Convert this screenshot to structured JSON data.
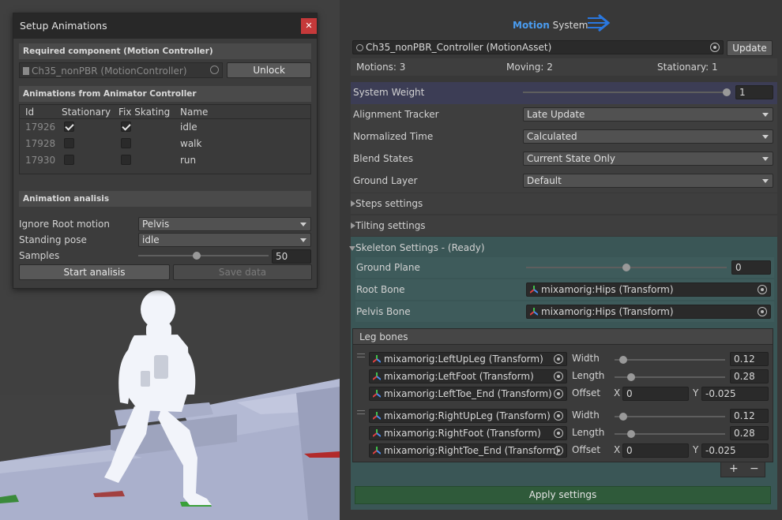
{
  "setup_window": {
    "title": "Setup Animations",
    "close_icon": "close-icon",
    "required_section": "Required component (Motion Controller)",
    "controller_field": "Ch35_nonPBR (MotionController)",
    "unlock_label": "Unlock",
    "animations_section": "Animations from Animator Controller",
    "columns": [
      "Id",
      "Stationary",
      "Fix Skating",
      "Name"
    ],
    "rows": [
      {
        "id": "17926",
        "stationary": true,
        "fix_skating": true,
        "name": "idle"
      },
      {
        "id": "17928",
        "stationary": false,
        "fix_skating": false,
        "name": "walk"
      },
      {
        "id": "17930",
        "stationary": false,
        "fix_skating": false,
        "name": "run"
      }
    ],
    "analysis_section": "Animation analisis",
    "ignore_root_label": "Ignore Root motion",
    "ignore_root_value": "Pelvis",
    "standing_pose_label": "Standing pose",
    "standing_pose_value": "idle",
    "samples_label": "Samples",
    "samples_value": "50",
    "samples_fraction": 0.45,
    "start_label": "Start analisis",
    "save_label": "Save data"
  },
  "inspector": {
    "logo_part1": "Motion",
    "logo_part2": "System",
    "asset_field": "Ch35_nonPBR_Controller (MotionAsset)",
    "update_label": "Update",
    "motions": "Motions: 3",
    "moving": "Moving: 2",
    "stationary": "Stationary: 1",
    "system_weight_label": "System Weight",
    "system_weight_value": "1",
    "alignment_label": "Alignment Tracker",
    "alignment_value": "Late Update",
    "normalized_label": "Normalized Time",
    "normalized_value": "Calculated",
    "blend_label": "Blend States",
    "blend_value": "Current State Only",
    "ground_label": "Ground Layer",
    "ground_value": "Default",
    "steps_label": "Steps settings",
    "tilting_label": "Tilting settings",
    "skeleton_label": "Skeleton Settings - (Ready)",
    "ground_plane_label": "Ground Plane",
    "ground_plane_value": "0",
    "root_bone_label": "Root Bone",
    "root_bone_value": "mixamorig:Hips (Transform)",
    "pelvis_bone_label": "Pelvis Bone",
    "pelvis_bone_value": "mixamorig:Hips (Transform)",
    "leg_bones_label": "Leg bones",
    "legs": [
      {
        "upleg": "mixamorig:LeftUpLeg (Transform)",
        "foot": "mixamorig:LeftFoot (Transform)",
        "toe": "mixamorig:LeftToe_End (Transform)",
        "width_label": "Width",
        "width": "0.12",
        "length_label": "Length",
        "length": "0.28",
        "offset_label": "Offset",
        "x_label": "X",
        "offset_x": "0",
        "y_label": "Y",
        "offset_y": "-0.025"
      },
      {
        "upleg": "mixamorig:RightUpLeg (Transform)",
        "foot": "mixamorig:RightFoot (Transform)",
        "toe": "mixamorig:RightToe_End (Transform)",
        "width_label": "Width",
        "width": "0.12",
        "length_label": "Length",
        "length": "0.28",
        "offset_label": "Offset",
        "x_label": "X",
        "offset_x": "0",
        "y_label": "Y",
        "offset_y": "-0.025"
      }
    ],
    "plus_label": "+",
    "minus_label": "−",
    "apply_label": "Apply settings",
    "colors": {
      "accent_blue": "#4a9cf0",
      "skeleton_bg": "#3a5656",
      "apply_bg": "#2f5a3a",
      "close_red": "#c5393a"
    }
  }
}
